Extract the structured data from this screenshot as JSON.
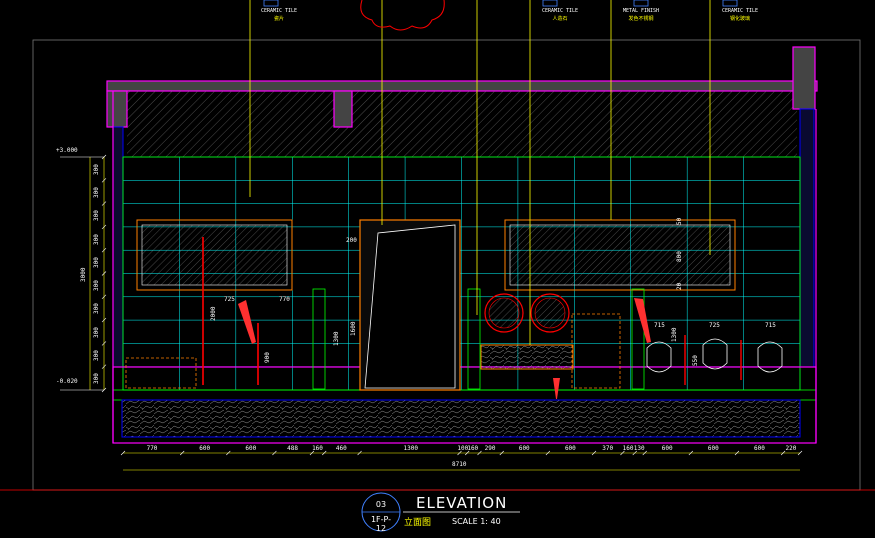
{
  "callouts": [
    {
      "en": "CERAMIC TILE",
      "zh": "瓷片"
    },
    {
      "en": "CERAMIC TILE",
      "zh": "人造石"
    },
    {
      "en": "METAL FINISH",
      "zh": "发色不锈钢"
    },
    {
      "en": "CERAMIC TILE",
      "zh": "钢化玻璃"
    }
  ],
  "title": {
    "number": "03",
    "sheet": "1F-P-12",
    "name": "ELEVATION",
    "zh_name": "立面图",
    "scale": "SCALE  1: 40"
  },
  "bottom_dims": [
    "770",
    "600",
    "600",
    "488",
    "160",
    "460",
    "1300",
    "100",
    "160",
    "290",
    "600",
    "600",
    "370",
    "160",
    "130",
    "600",
    "600",
    "600",
    "220"
  ],
  "overall_dim": "8710",
  "left_dims": [
    "300",
    "300",
    "300",
    "300",
    "300",
    "300",
    "300",
    "300",
    "300",
    "300"
  ],
  "left_total": "3000",
  "level_top": "+3.000",
  "level_bottom": "-0.020",
  "inner_dims": {
    "d725a": "725",
    "d770": "770",
    "d2000": "2000",
    "d900": "900",
    "d200": "200",
    "d1600": "1600",
    "d1300a": "1300",
    "d1300b": "1300",
    "d550": "550",
    "d715a": "715",
    "d725b": "725",
    "d715b": "715",
    "d50": "50",
    "d800": "800",
    "d20": "20"
  },
  "colors": {
    "wall": "#ff00ff",
    "tile": "#00ffff",
    "green": "#00ff00",
    "yellow": "#ffff00",
    "red": "#ff0000",
    "blue": "#0000ff",
    "orange": "#ff7f00",
    "white": "#ffffff"
  }
}
